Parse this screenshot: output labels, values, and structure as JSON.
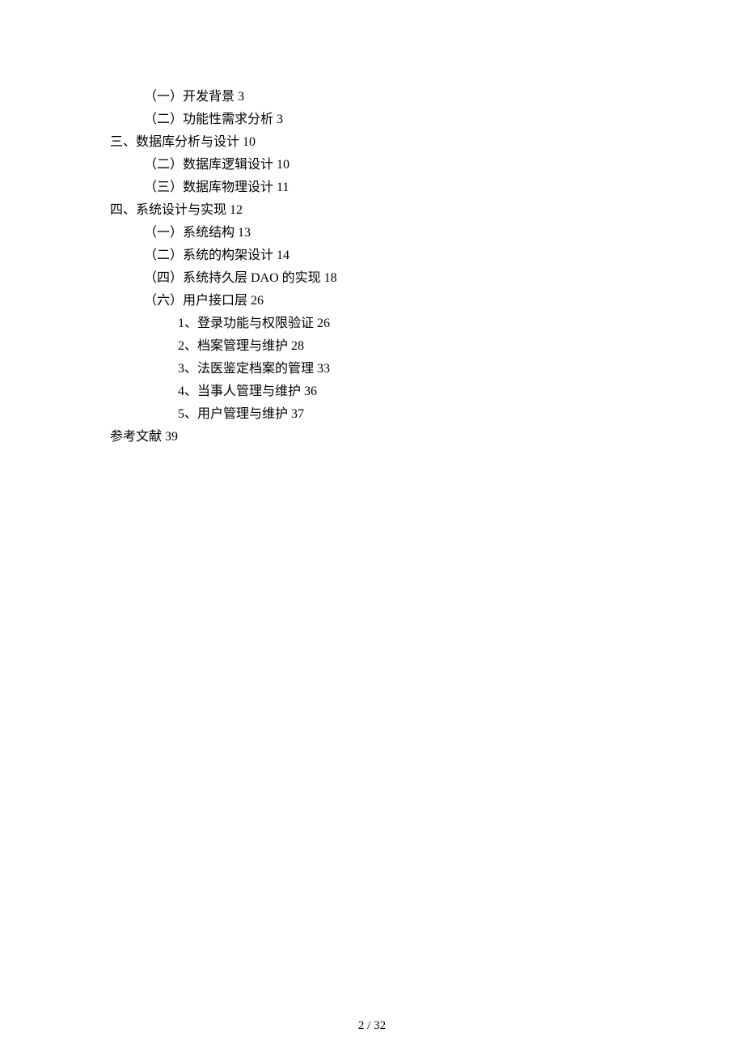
{
  "toc": {
    "lines": [
      {
        "indent": 1,
        "text": "（一）开发背景 3"
      },
      {
        "indent": 1,
        "text": "（二）功能性需求分析 3"
      },
      {
        "indent": 0,
        "text": "三、数据库分析与设计 10"
      },
      {
        "indent": 1,
        "text": "（二）数据库逻辑设计 10"
      },
      {
        "indent": 1,
        "text": "（三）数据库物理设计 11"
      },
      {
        "indent": 0,
        "text": "四、系统设计与实现 12"
      },
      {
        "indent": 1,
        "text": "（一）系统结构 13"
      },
      {
        "indent": 1,
        "text": "（二）系统的构架设计 14"
      },
      {
        "indent": 1,
        "text": "（四）系统持久层 DAO 的实现 18"
      },
      {
        "indent": 1,
        "text": "（六）用户接口层 26"
      },
      {
        "indent": 2,
        "text": "1、登录功能与权限验证 26"
      },
      {
        "indent": 2,
        "text": "2、档案管理与维护 28"
      },
      {
        "indent": 2,
        "text": "3、法医鉴定档案的管理 33"
      },
      {
        "indent": 2,
        "text": "4、当事人管理与维护 36"
      },
      {
        "indent": 2,
        "text": "5、用户管理与维护 37"
      },
      {
        "indent": 0,
        "text": "参考文献 39"
      }
    ]
  },
  "footer": {
    "page": "2  / 32"
  }
}
